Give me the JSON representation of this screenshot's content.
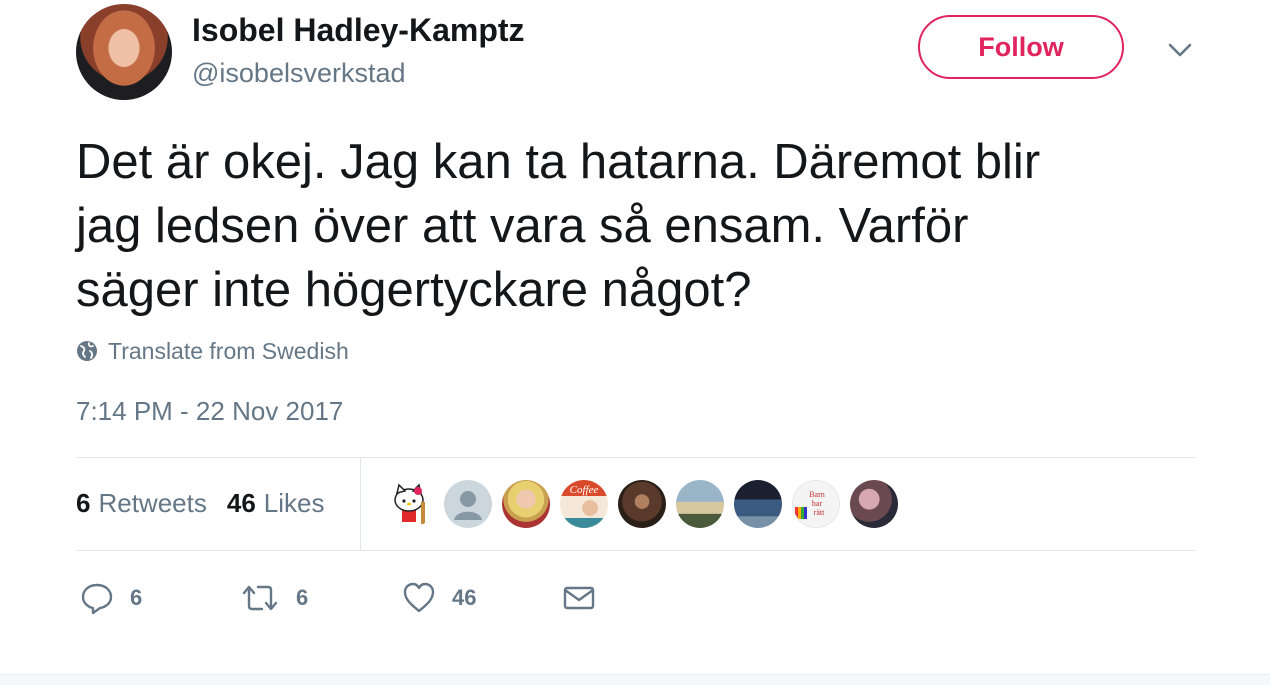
{
  "user": {
    "name": "Isobel Hadley-Kamptz",
    "handle": "@isobelsverkstad"
  },
  "follow_label": "Follow",
  "tweet": {
    "lines": [
      "Det är okej. Jag kan ta hatarna. Däremot blir",
      "jag ledsen över att vara så ensam. Varför",
      "säger inte högertyckare något?"
    ],
    "translate_label": "Translate from Swedish",
    "timestamp": "7:14 PM - 22 Nov 2017"
  },
  "stats": {
    "retweets_count": "6",
    "retweets_label": "Retweets",
    "likes_count": "46",
    "likes_label": "Likes"
  },
  "liker_avatars": [
    {
      "name": "hello-kitty-avatar"
    },
    {
      "name": "default-avatar",
      "text": ""
    },
    {
      "name": "woman-blonde-avatar"
    },
    {
      "name": "coffee-avatar",
      "text": "Coffee"
    },
    {
      "name": "bearded-man-avatar"
    },
    {
      "name": "landscape-avatar"
    },
    {
      "name": "feet-avatar"
    },
    {
      "name": "barn-har-ratt-avatar",
      "text": "Barn har rätt"
    },
    {
      "name": "blossom-avatar"
    }
  ],
  "actions": {
    "reply_count": "6",
    "retweet_count": "6",
    "like_count": "46"
  },
  "colors": {
    "accent": "#e0245e",
    "secondary_text": "#657786",
    "primary_text": "#14171a",
    "divider": "#e1e8ed"
  }
}
